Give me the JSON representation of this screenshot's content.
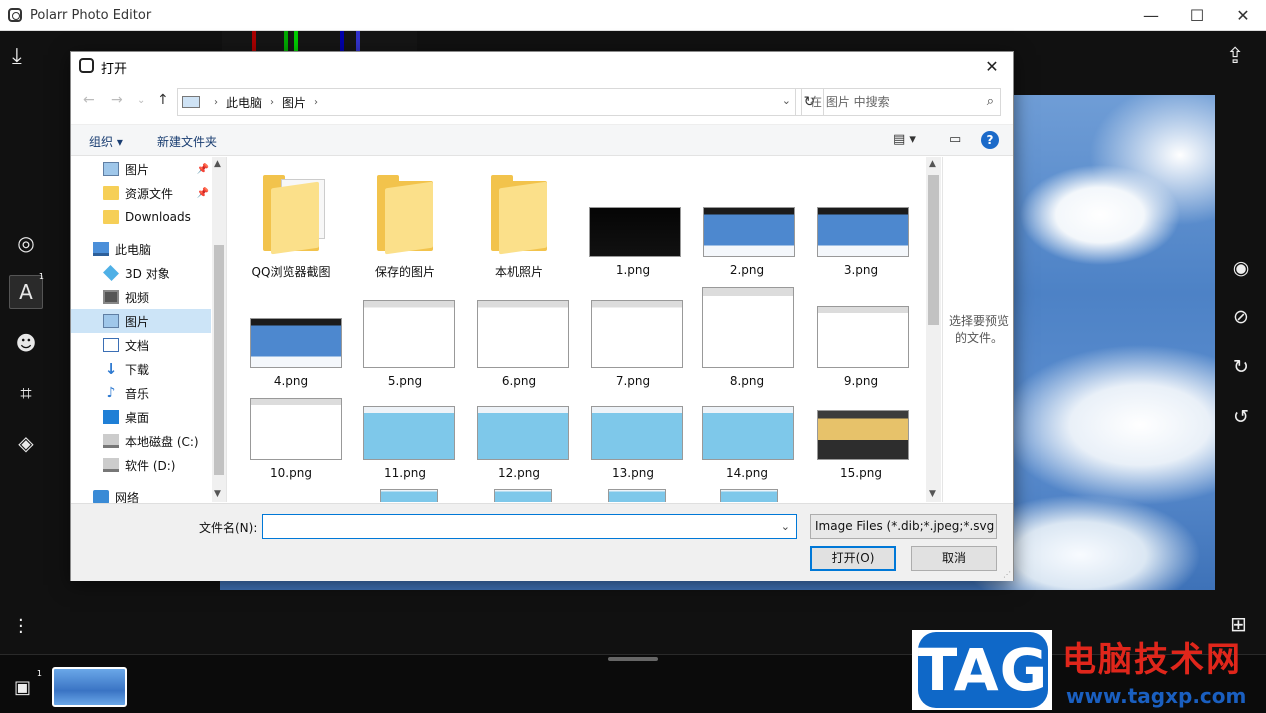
{
  "app": {
    "title": "Polarr Photo Editor",
    "window_controls": {
      "minimize": "—",
      "maximize": "☐",
      "close": "✕"
    },
    "rail_badge_text": "1",
    "gallery_badge": "1"
  },
  "dialog": {
    "title": "打开",
    "breadcrumb": [
      "此电脑",
      "图片"
    ],
    "search_placeholder": "在 图片 中搜索",
    "organize_label": "组织 ▾",
    "new_folder_label": "新建文件夹",
    "help_label": "?",
    "nav_items": [
      {
        "label": "图片",
        "icon": "pictures-icon",
        "pinned": true
      },
      {
        "label": "资源文件",
        "icon": "folder-icon",
        "pinned": true
      },
      {
        "label": "Downloads",
        "icon": "folder-icon",
        "pinned": false
      },
      {
        "label": "此电脑",
        "icon": "computer-icon",
        "pinned": false
      },
      {
        "label": "3D 对象",
        "icon": "3d-objects-icon",
        "pinned": false
      },
      {
        "label": "视频",
        "icon": "video-icon",
        "pinned": false
      },
      {
        "label": "图片",
        "icon": "pictures-icon",
        "pinned": false,
        "selected": true
      },
      {
        "label": "文档",
        "icon": "documents-icon",
        "pinned": false
      },
      {
        "label": "下载",
        "icon": "download-icon",
        "pinned": false
      },
      {
        "label": "音乐",
        "icon": "music-icon",
        "pinned": false
      },
      {
        "label": "桌面",
        "icon": "desktop-icon",
        "pinned": false
      },
      {
        "label": "本地磁盘 (C:)",
        "icon": "drive-icon",
        "pinned": false
      },
      {
        "label": "软件 (D:)",
        "icon": "drive-icon",
        "pinned": false
      },
      {
        "label": "网络",
        "icon": "network-icon",
        "pinned": false
      }
    ],
    "files": [
      {
        "name": "QQ浏览器截图",
        "kind": "folder"
      },
      {
        "name": "保存的图片",
        "kind": "folder"
      },
      {
        "name": "本机照片",
        "kind": "folder"
      },
      {
        "name": "1.png",
        "kind": "dark"
      },
      {
        "name": "2.png",
        "kind": "blue"
      },
      {
        "name": "3.png",
        "kind": "blue"
      },
      {
        "name": "4.png",
        "kind": "blue"
      },
      {
        "name": "5.png",
        "kind": "win"
      },
      {
        "name": "6.png",
        "kind": "win"
      },
      {
        "name": "7.png",
        "kind": "win"
      },
      {
        "name": "8.png",
        "kind": "win"
      },
      {
        "name": "9.png",
        "kind": "win"
      },
      {
        "name": "10.png",
        "kind": "win"
      },
      {
        "name": "11.png",
        "kind": "sky"
      },
      {
        "name": "12.png",
        "kind": "sky"
      },
      {
        "name": "13.png",
        "kind": "sky"
      },
      {
        "name": "14.png",
        "kind": "sky"
      },
      {
        "name": "15.png",
        "kind": "ps"
      }
    ],
    "preview_text": "选择要预览的文件。",
    "filename_label": "文件名(N):",
    "filename_value": "",
    "filetype_value": "Image Files (*.dib;*.jpeg;*.svg",
    "open_button": "打开(O)",
    "cancel_button": "取消"
  },
  "watermark": {
    "logo_text": "TAG",
    "site_name": "电脑技术网",
    "url": "www.tagxp.com"
  }
}
